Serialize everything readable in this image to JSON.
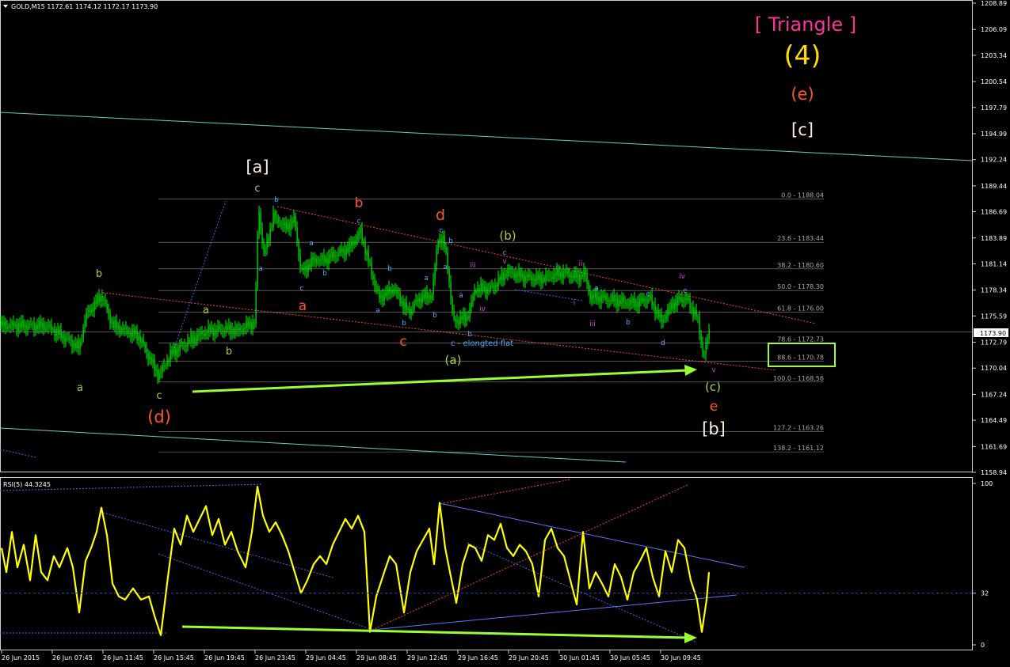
{
  "chart_data": {
    "type": "candlestick",
    "symbol_header": "GOLD,M15  1172.61 1174.12 1172.17 1173.90",
    "current_price": "1173.90",
    "price_axis": {
      "ticks": [
        "1208.89",
        "1206.09",
        "1203.34",
        "1200.54",
        "1197.79",
        "1194.99",
        "1192.24",
        "1189.44",
        "1186.69",
        "1183.89",
        "1181.14",
        "1178.34",
        "1175.59",
        "1172.79",
        "1170.04",
        "1167.24",
        "1164.49",
        "1161.69",
        "1158.94"
      ],
      "ylim": [
        1158.94,
        1208.89
      ]
    },
    "time_axis": {
      "ticks": [
        "26 Jun 2015",
        "26 Jun 07:45",
        "26 Jun 11:45",
        "26 Jun 15:45",
        "26 Jun 19:45",
        "26 Jun 23:45",
        "29 Jun 04:45",
        "29 Jun 08:45",
        "29 Jun 12:45",
        "29 Jun 16:45",
        "29 Jun 20:45",
        "30 Jun 01:45",
        "30 Jun 05:45",
        "30 Jun 09:45"
      ]
    },
    "fibonacci_levels": [
      {
        "label": "0.0 - 1188.04",
        "price": 1188.04
      },
      {
        "label": "23.6 - 1183.44",
        "price": 1183.44
      },
      {
        "label": "38.2 - 1180.60",
        "price": 1180.6
      },
      {
        "label": "50.0 - 1178.30",
        "price": 1178.3
      },
      {
        "label": "61.8 - 1176.00",
        "price": 1176.0
      },
      {
        "label": "78.6 - 1172.73",
        "price": 1172.73
      },
      {
        "label": "88.6 - 1170.78",
        "price": 1170.78
      },
      {
        "label": "100.0 - 1168.56",
        "price": 1168.56
      },
      {
        "label": "127.2 - 1163.26",
        "price": 1163.26
      },
      {
        "label": "138.2 - 1161.12",
        "price": 1161.12
      }
    ],
    "big_labels": {
      "triangle": "[ Triangle ]",
      "four": "(4)",
      "e_paren": "(e)",
      "c_bracket": "[c]",
      "a_bracket": "[a]",
      "b_bracket": "[b]",
      "d_paren": "(d)",
      "b_paren": "(b)",
      "a_paren": "(a)",
      "c_paren": "(c)"
    },
    "annotations": {
      "elongated_flat": "c - elongted flat"
    },
    "rsi": {
      "title": "RSI(5) 44.3245",
      "ticks": [
        "100",
        "32",
        "0"
      ],
      "ylim": [
        0,
        100
      ]
    },
    "colors": {
      "candles": "#00ff00",
      "rsi_line": "#ffff00",
      "arrow": "#99ff33",
      "fib_lines": "#888888",
      "cyan_lines": "#66cccc",
      "triangle_text": "#ff3399",
      "wave_orange": "#ff5522",
      "wave_yellow": "#ffdd00",
      "wave_olive": "#aacc44",
      "wave_cream": "#ffeedd",
      "wave_blue": "#44aaff",
      "wave_magenta": "#cc44cc"
    }
  }
}
